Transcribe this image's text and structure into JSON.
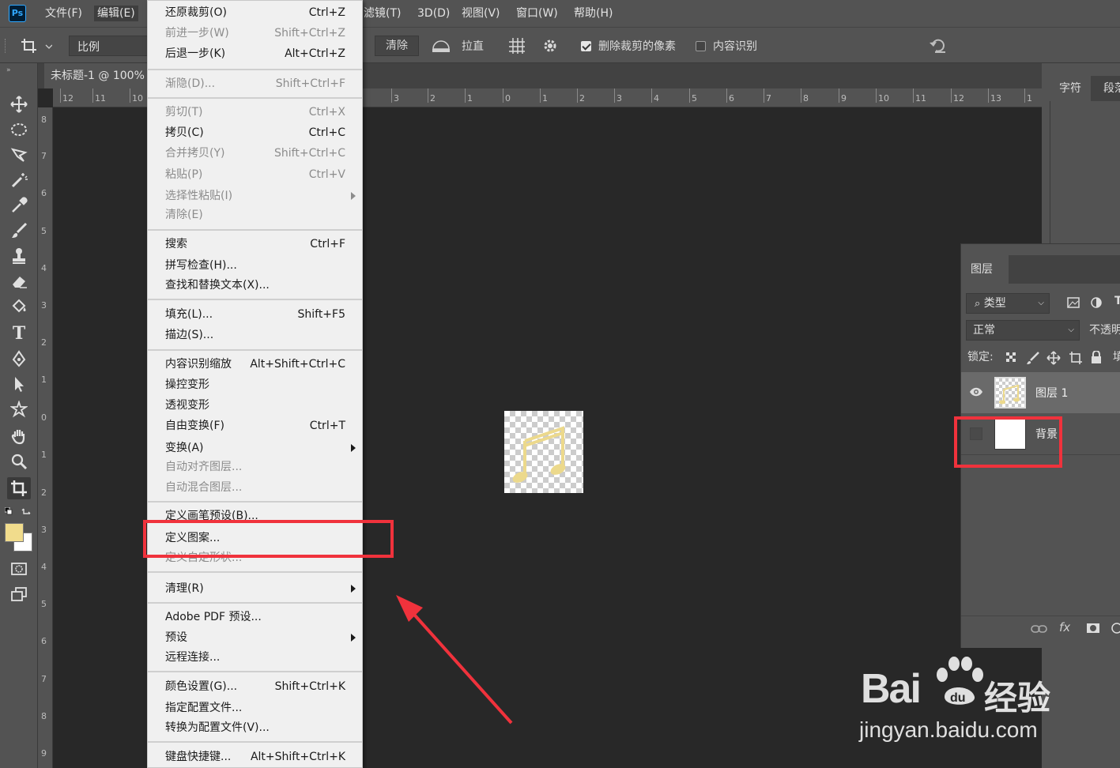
{
  "menubar": {
    "logo": "Ps",
    "items": [
      {
        "label": "文件(F)"
      },
      {
        "label": "编辑(E)"
      },
      {
        "label": "滤镜(T)"
      },
      {
        "label": "3D(D)"
      },
      {
        "label": "视图(V)"
      },
      {
        "label": "窗口(W)"
      },
      {
        "label": "帮助(H)"
      }
    ]
  },
  "options": {
    "ratio": "比例",
    "clear": "清除",
    "straighten": "拉直",
    "delete_cropped": "删除裁剪的像素",
    "content_aware": "内容识别",
    "delete_cropped_checked": true,
    "content_aware_checked": false
  },
  "document": {
    "tab": "未标题-1 @ 100%"
  },
  "ruler_h": [
    "12",
    "11",
    "10",
    "3",
    "2",
    "1",
    "0",
    "1",
    "2",
    "3",
    "4",
    "5",
    "6",
    "7",
    "8",
    "9",
    "10",
    "11",
    "12",
    "13",
    "1"
  ],
  "ruler_v": [
    "8",
    "7",
    "6",
    "5",
    "4",
    "3",
    "2",
    "1",
    "0",
    "1",
    "2",
    "3",
    "4",
    "5",
    "6",
    "7",
    "8",
    "9"
  ],
  "panels": {
    "character_tab": "字符",
    "paragraph_tab": "段落"
  },
  "layers": {
    "tab": "图层",
    "filter_kind": "类型",
    "blend_mode": "正常",
    "opacity_label": "不透明",
    "lock_label": "锁定:",
    "fill_label": "填",
    "items": [
      {
        "name": "图层 1"
      },
      {
        "name": "背景"
      }
    ]
  },
  "edit_menu": {
    "items": [
      {
        "label": "还原裁剪(O)",
        "shortcut": "Ctrl+Z"
      },
      {
        "label": "前进一步(W)",
        "shortcut": "Shift+Ctrl+Z"
      },
      {
        "label": "后退一步(K)",
        "shortcut": "Alt+Ctrl+Z"
      },
      {
        "label": "渐隐(D)...",
        "shortcut": "Shift+Ctrl+F"
      },
      {
        "label": "剪切(T)",
        "shortcut": "Ctrl+X"
      },
      {
        "label": "拷贝(C)",
        "shortcut": "Ctrl+C"
      },
      {
        "label": "合并拷贝(Y)",
        "shortcut": "Shift+Ctrl+C"
      },
      {
        "label": "粘贴(P)",
        "shortcut": "Ctrl+V"
      },
      {
        "label": "选择性粘贴(I)",
        "shortcut": ""
      },
      {
        "label": "清除(E)",
        "shortcut": ""
      },
      {
        "label": "搜索",
        "shortcut": "Ctrl+F"
      },
      {
        "label": "拼写检查(H)...",
        "shortcut": ""
      },
      {
        "label": "查找和替换文本(X)...",
        "shortcut": ""
      },
      {
        "label": "填充(L)...",
        "shortcut": "Shift+F5"
      },
      {
        "label": "描边(S)...",
        "shortcut": ""
      },
      {
        "label": "内容识别缩放",
        "shortcut": "Alt+Shift+Ctrl+C"
      },
      {
        "label": "操控变形",
        "shortcut": ""
      },
      {
        "label": "透视变形",
        "shortcut": ""
      },
      {
        "label": "自由变换(F)",
        "shortcut": "Ctrl+T"
      },
      {
        "label": "变换(A)",
        "shortcut": ""
      },
      {
        "label": "自动对齐图层...",
        "shortcut": ""
      },
      {
        "label": "自动混合图层...",
        "shortcut": ""
      },
      {
        "label": "定义画笔预设(B)...",
        "shortcut": ""
      },
      {
        "label": "定义图案...",
        "shortcut": ""
      },
      {
        "label": "定义自定形状...",
        "shortcut": ""
      },
      {
        "label": "清理(R)",
        "shortcut": ""
      },
      {
        "label": "Adobe PDF 预设...",
        "shortcut": ""
      },
      {
        "label": "预设",
        "shortcut": ""
      },
      {
        "label": "远程连接...",
        "shortcut": ""
      },
      {
        "label": "颜色设置(G)...",
        "shortcut": "Shift+Ctrl+K"
      },
      {
        "label": "指定配置文件...",
        "shortcut": ""
      },
      {
        "label": "转换为配置文件(V)...",
        "shortcut": ""
      },
      {
        "label": "键盘快捷键...",
        "shortcut": "Alt+Shift+Ctrl+K"
      }
    ]
  },
  "watermark": {
    "brand": "Bai",
    "brand2": "经验",
    "url": "jingyan.baidu.com"
  },
  "colors": {
    "annotation_red": "#f0323c",
    "foreground_swatch": "#f1dc8c",
    "background_swatch": "#ffffff"
  }
}
